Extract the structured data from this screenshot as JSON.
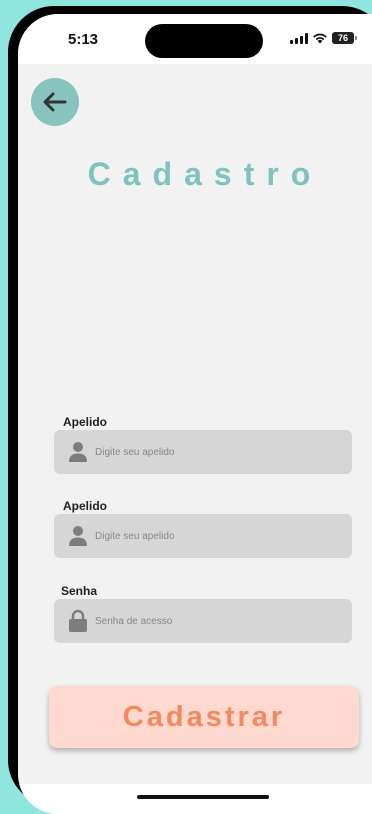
{
  "status_bar": {
    "time": "5:13",
    "battery": "76",
    "icons": [
      "signal-icon",
      "wifi-icon",
      "battery-icon"
    ]
  },
  "header": {
    "back_icon": "arrow-left-icon",
    "title": "Cadastro"
  },
  "form": {
    "fields": [
      {
        "label": "Apelido",
        "placeholder": "Digite seu apelido",
        "icon": "user-icon"
      },
      {
        "label": "Apelido",
        "placeholder": "Digite seu apelido",
        "icon": "user-icon"
      },
      {
        "label": "Senha",
        "placeholder": "Senha de acesso",
        "icon": "lock-icon"
      }
    ],
    "submit_label": "Cadastrar"
  },
  "colors": {
    "background": "#8ee6df",
    "accent": "#7cc4bd",
    "button_bg": "#ffd8cf",
    "button_text": "#f4895c",
    "input_bg": "#d6d6d6"
  }
}
